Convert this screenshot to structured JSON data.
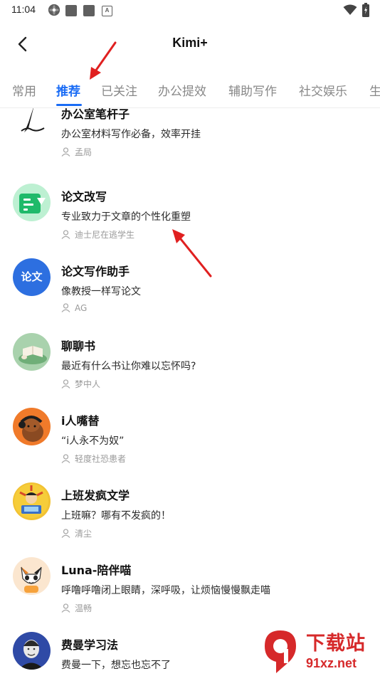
{
  "status_bar": {
    "time": "11:04",
    "a_badge": "A"
  },
  "header": {
    "title": "Kimi+"
  },
  "tabs": [
    {
      "label": "常用"
    },
    {
      "label": "推荐"
    },
    {
      "label": "已关注"
    },
    {
      "label": "办公提效"
    },
    {
      "label": "辅助写作"
    },
    {
      "label": "社交娱乐"
    },
    {
      "label": "生"
    }
  ],
  "active_tab": "推荐",
  "items": [
    {
      "title": "办公室笔杆子",
      "desc": "办公室材料写作必备，效率开挂",
      "author": "孟局"
    },
    {
      "title": "论文改写",
      "desc": "专业致力于文章的个性化重塑",
      "author": "迪士尼在逃学生"
    },
    {
      "title": "论文写作助手",
      "desc": "像教授一样写论文",
      "author": "AG",
      "avatar_text": "论文"
    },
    {
      "title": "聊聊书",
      "desc": "最近有什么书让你难以忘怀吗?",
      "author": "梦中人"
    },
    {
      "title": "i人嘴替",
      "desc": "“i人永不为奴”",
      "author": "轻度社恐患者"
    },
    {
      "title": "上班发疯文学",
      "desc": "上班嘛？哪有不发疯的！",
      "author": "清尘"
    },
    {
      "title": "Luna-陪伴喵",
      "desc": "呼噜呼噜闭上眼睛，深呼吸，让烦恼慢慢飘走喵",
      "author": "温畅"
    },
    {
      "title": "费曼学习法",
      "desc": "费曼一下，想忘也忘不了",
      "author": ""
    }
  ],
  "watermark": {
    "text": "下载站",
    "url": "91xz.net"
  },
  "colors": {
    "accent": "#1a6cf5",
    "annotation_arrow": "#e02020",
    "watermark": "#d6292a"
  }
}
